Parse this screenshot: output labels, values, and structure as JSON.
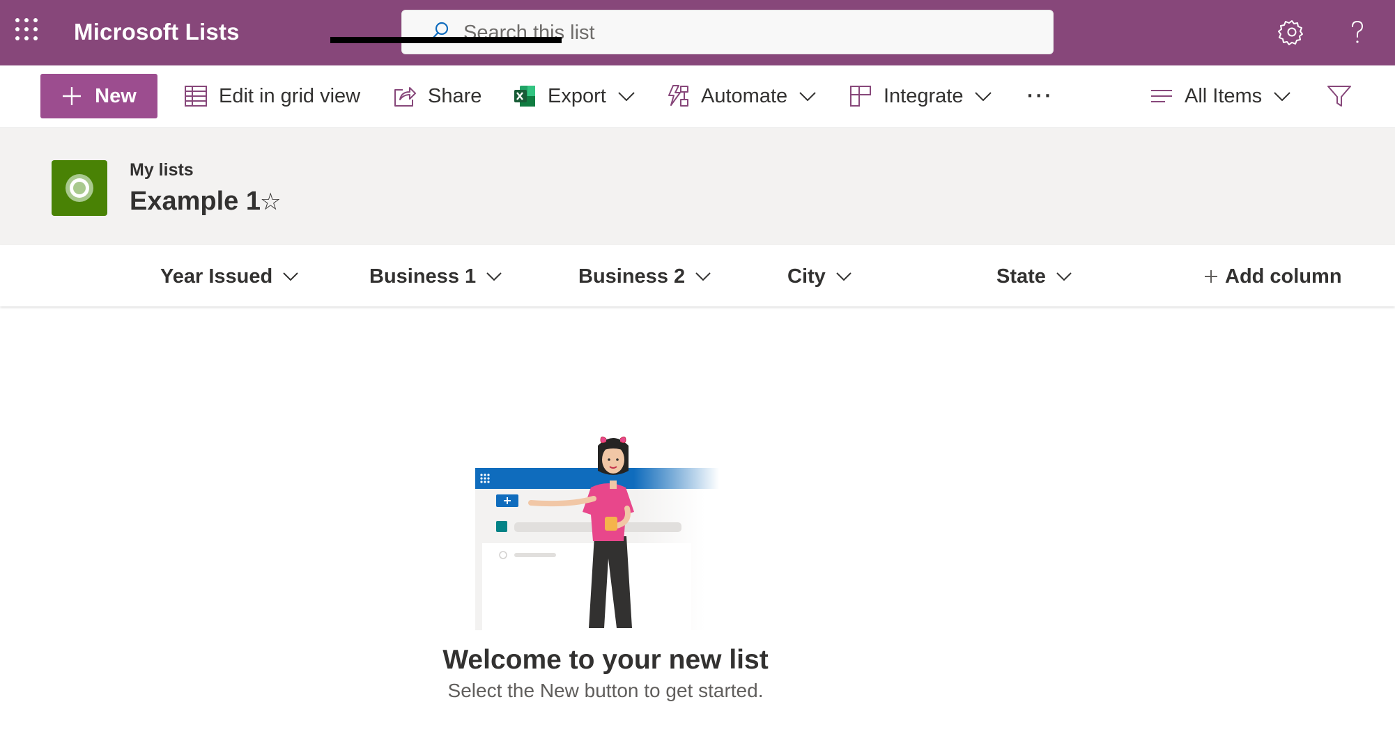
{
  "app": {
    "title": "Microsoft Lists"
  },
  "search": {
    "placeholder": "Search this list"
  },
  "toolbar": {
    "new_label": "New",
    "edit_grid_label": "Edit in grid view",
    "share_label": "Share",
    "export_label": "Export",
    "automate_label": "Automate",
    "integrate_label": "Integrate",
    "more_label": "···",
    "view_label": "All Items"
  },
  "header": {
    "breadcrumb": "My lists",
    "list_title": "Example 1",
    "favorite_glyph": "☆",
    "list_icon_color": "#498205"
  },
  "columns": {
    "c1": "Year Issued",
    "c2": "Business 1",
    "c3": "Business 2",
    "c4": "City",
    "c5": "State",
    "add": "Add column"
  },
  "empty_state": {
    "title": "Welcome to your new list",
    "subtitle": "Select the New button to get started."
  },
  "colors": {
    "suite_bar": "#87477a",
    "accent_button": "#9c4d8f",
    "header_band": "#f3f2f1"
  },
  "icons": [
    "waffle-icon",
    "search-icon",
    "settings-icon",
    "help-icon",
    "plus-icon",
    "grid-icon",
    "share-icon",
    "excel-icon",
    "automate-icon",
    "integrate-icon",
    "view-lines-icon",
    "filter-icon",
    "star-icon"
  ]
}
